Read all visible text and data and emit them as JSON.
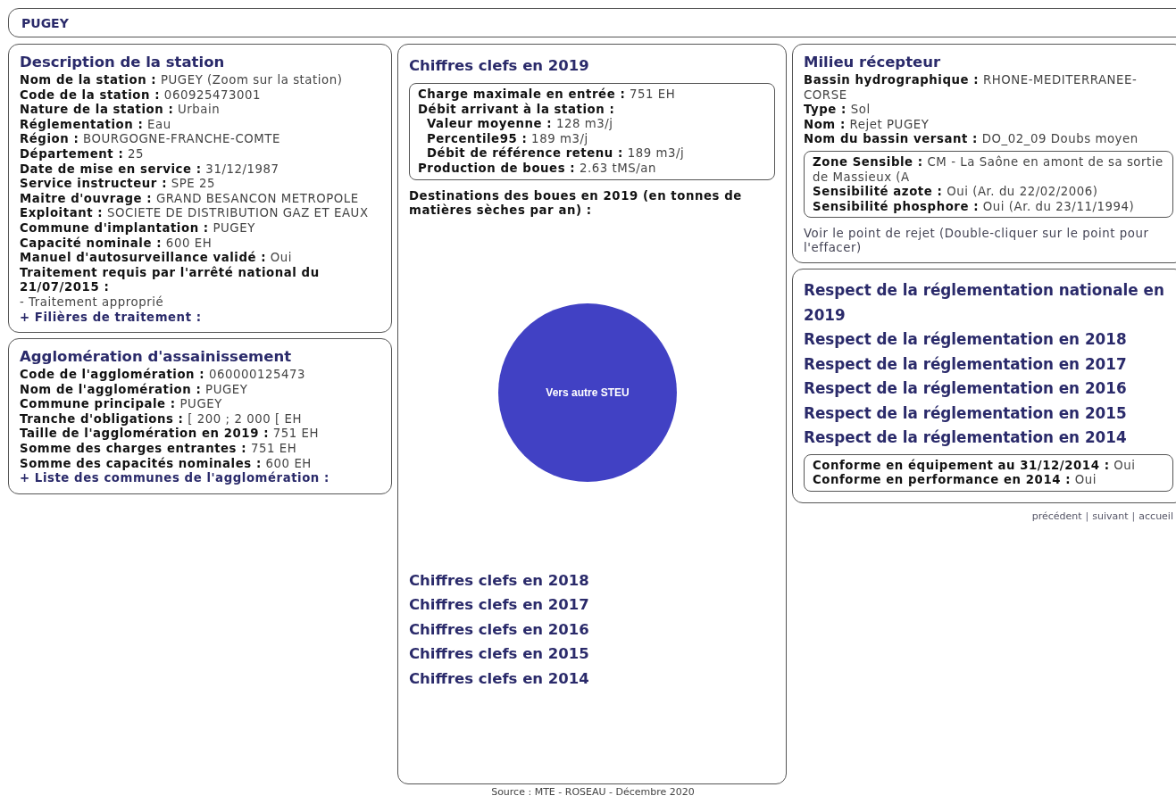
{
  "page_title": "PUGEY",
  "left_panels": [
    {
      "title": "Description de la station",
      "rows": [
        {
          "kind": "field",
          "text": "**Nom de la station :** PUGEY (Zoom sur la station)"
        },
        {
          "kind": "field",
          "text": "**Code de la station :** 060925473001"
        },
        {
          "kind": "field",
          "text": "**Nature de la station :** Urbain"
        },
        {
          "kind": "field",
          "text": "**Réglementation :** Eau"
        },
        {
          "kind": "field",
          "text": "**Région :** BOURGOGNE-FRANCHE-COMTE"
        },
        {
          "kind": "field",
          "text": "**Département :** 25"
        },
        {
          "kind": "field",
          "text": "**Date de mise en service :** 31/12/1987"
        },
        {
          "kind": "field",
          "text": "**Service instructeur :** SPE 25"
        },
        {
          "kind": "field",
          "text": "**Maitre d'ouvrage :** GRAND BESANCON METROPOLE"
        },
        {
          "kind": "field",
          "text": "**Exploitant :** SOCIETE DE DISTRIBUTION GAZ ET EAUX"
        },
        {
          "kind": "field",
          "text": "**Commune d'implantation :** PUGEY"
        },
        {
          "kind": "field",
          "text": "**Capacité nominale :** 600 EH"
        },
        {
          "kind": "field",
          "text": "**Manuel d'autosurveillance validé :** Oui"
        },
        {
          "kind": "heading",
          "text": "Traitement requis par l'arrêté national du 21/07/2015  :"
        },
        {
          "kind": "text",
          "text": "- Traitement approprié"
        },
        {
          "kind": "link",
          "text": "+ Filières de traitement :"
        }
      ]
    },
    {
      "title": "Agglomération d'assainissement",
      "rows": [
        {
          "kind": "field",
          "text": "**Code de l'agglomération :** 060000125473"
        },
        {
          "kind": "field",
          "text": "**Nom de l'agglomération :** PUGEY"
        },
        {
          "kind": "field",
          "text": "**Commune principale :** PUGEY"
        },
        {
          "kind": "field",
          "text": "**Tranche d'obligations :** [ 200 ; 2 000 [ EH"
        },
        {
          "kind": "field",
          "text": "**Taille de l'agglomération en 2019 :** 751 EH"
        },
        {
          "kind": "field",
          "text": "**Somme des charges entrantes :** 751 EH"
        },
        {
          "kind": "field",
          "text": "**Somme des capacités nominales :** 600 EH"
        },
        {
          "kind": "link",
          "text": "+ Liste des communes de l'agglomération :"
        }
      ]
    }
  ],
  "key_figures": {
    "title": "Chiffres clefs en 2019",
    "box_rows": [
      {
        "kind": "field",
        "text": "**Charge maximale en entrée  :** 751 EH"
      },
      {
        "kind": "heading",
        "text": "Débit arrivant à la station :",
        "children": [
          {
            "kind": "field",
            "text": "**Valeur moyenne :** 128 m3/j"
          },
          {
            "kind": "field",
            "text": "**Percentile95 :** 189 m3/j"
          },
          {
            "kind": "field",
            "text": "**Débit de référence retenu :** 189 m3/j"
          }
        ]
      },
      {
        "kind": "field",
        "text": "**Production de boues :** 2.63 tMS/an"
      }
    ],
    "sludge_heading": "Destinations des boues en 2019 (en tonnes de matières sèches par an) :",
    "pie_label": "Vers autre STEU",
    "year_links": [
      "Chiffres clefs en 2018",
      "Chiffres clefs en 2017",
      "Chiffres clefs en 2016",
      "Chiffres clefs en 2015",
      "Chiffres clefs en 2014"
    ]
  },
  "receiving_environment": {
    "title": "Milieu récepteur",
    "rows": [
      {
        "kind": "field",
        "text": "**Bassin hydrographique :** RHONE-MEDITERRANEE-CORSE"
      },
      {
        "kind": "field",
        "text": "**Type :** Sol"
      },
      {
        "kind": "field",
        "text": "**Nom :** Rejet PUGEY"
      },
      {
        "kind": "field",
        "text": "**Nom du bassin versant :** DO_02_09 Doubs moyen"
      }
    ],
    "box_rows": [
      {
        "kind": "field",
        "text": "**Zone Sensible :** CM - La Saône en amont de sa sortie de Massieux (A"
      },
      {
        "kind": "field",
        "text": "**Sensibilité azote :** Oui (Ar. du 22/02/2006)"
      },
      {
        "kind": "field",
        "text": "**Sensibilité phosphore :** Oui (Ar. du 23/11/1994)"
      }
    ],
    "map_link": "Voir le point de rejet (Double-cliquer sur le point pour l'effacer)"
  },
  "compliance": {
    "year_links": [
      "Respect de la réglementation nationale en 2019",
      "Respect de la réglementation en 2018",
      "Respect de la réglementation en 2017",
      "Respect de la réglementation en 2016",
      "Respect de la réglementation en 2015",
      "Respect de la réglementation en 2014"
    ],
    "box_rows": [
      {
        "kind": "field",
        "text": "**Conforme en équipement au 31/12/2014 :** Oui"
      },
      {
        "kind": "field",
        "text": "**Conforme en performance en 2014 :** Oui"
      }
    ]
  },
  "nav_links": [
    "précédent",
    "suivant",
    "accueil"
  ],
  "nav_separator": "|",
  "footer": "Source : MTE - ROSEAU - Décembre 2020"
}
